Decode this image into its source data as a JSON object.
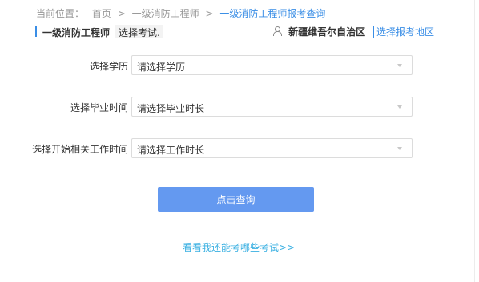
{
  "breadcrumb": {
    "prefix": "当前位置：",
    "home": "首页",
    "separator": ">",
    "category": "一级消防工程师",
    "current": "一级消防工程师报考查询"
  },
  "exam": {
    "title": "一级消防工程师",
    "change_label": "选择考试."
  },
  "region": {
    "icon": "person-icon",
    "name": "新疆维吾尔自治区",
    "select_label": "选择报考地区"
  },
  "form": {
    "education": {
      "label": "选择学历",
      "placeholder": "请选择学历"
    },
    "graduation": {
      "label": "选择毕业时间",
      "placeholder": "请选择毕业时长"
    },
    "work": {
      "label": "选择开始相关工作时间",
      "placeholder": "请选择工作时长"
    }
  },
  "submit_label": "点击查询",
  "more_link": "看看我还能考哪些考试>>",
  "colors": {
    "accent": "#3a8ee6",
    "button": "#6499f0",
    "link": "#3ab0e2"
  }
}
